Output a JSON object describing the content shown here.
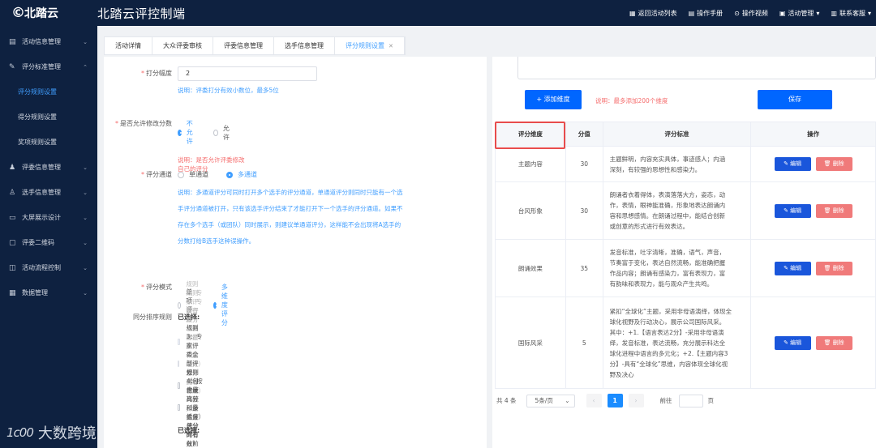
{
  "header": {
    "logo_text": "北踏云",
    "title": "北踏云评控制端",
    "actions": [
      {
        "label": "返回活动列表",
        "icon": "grid-icon"
      },
      {
        "label": "操作手册",
        "icon": "book-icon"
      },
      {
        "label": "操作视频",
        "icon": "play-icon"
      },
      {
        "label": "活动管理",
        "icon": "doc-icon",
        "dropdown": true
      },
      {
        "label": "联系客服",
        "icon": "phone-icon",
        "dropdown": true
      }
    ]
  },
  "sidebar": {
    "items": [
      {
        "label": "活动信息管理"
      },
      {
        "label": "评分标准管理",
        "expanded": true,
        "children": [
          "评分规则设置",
          "得分规则设置",
          "奖项规则设置"
        ]
      },
      {
        "label": "评委信息管理"
      },
      {
        "label": "选手信息管理"
      },
      {
        "label": "大屏展示设计"
      },
      {
        "label": "评委二维码"
      },
      {
        "label": "活动流程控制"
      },
      {
        "label": "数据管理"
      }
    ],
    "active_sub": "评分规则设置"
  },
  "watermark": {
    "logo": "1c00",
    "text": "大数跨境"
  },
  "tabs": [
    "活动详情",
    "大众评委审核",
    "评委信息管理",
    "选手信息管理",
    "评分规则设置"
  ],
  "active_tab": "评分规则设置",
  "form": {
    "step": {
      "label": "打分幅度",
      "value": "2",
      "note": "说明：评委打分有效小数位，最多5位"
    },
    "allow_modify": {
      "label": "是否允许修改分数",
      "options": [
        "不允许",
        "允许"
      ],
      "selected": "不允许",
      "note": "说明：是否允许评委修改自己的评分"
    },
    "channel": {
      "label": "评分通道",
      "options": [
        "单通道",
        "多通道"
      ],
      "selected": "多通道",
      "note_lines": [
        "说明：多通道评分可同时打开多个选手的评分通道，单通道评分则同时只能有一个选",
        "手评分通道被打开，只有该选手评分结束了才能打开下一个选手的评分通道。如果不",
        "存在多个选手（或团队）同时展示，则建议单通道评分，这样能不会出现将A选手的",
        "分数打给B选手这种误操作。"
      ]
    },
    "mode": {
      "label": "评分模式",
      "options": [
        "单项评分",
        "多维度评分"
      ],
      "selected": "多维度评分"
    },
    "tie_rule": {
      "label": "同分排序规则",
      "selected_label": "已选择:",
      "rules": [
        {
          "text": "规则1：专家评委分值高者在前（启动大众评委时有效）",
          "disabled": true
        },
        {
          "text": "规则2：专家评委有效分（去掉最高分和最低分）总分高者在前（去掉最高最低分时有效）",
          "disabled": true
        },
        {
          "text": "规则3：专家评委全部评分（包含最高分和最低分）总分高者在前",
          "disabled": false
        },
        {
          "text": "规则4：按维度比较（多维度评分时有效）",
          "disabled": false
        }
      ],
      "selected_label_2": "已选择:"
    }
  },
  "dimension": {
    "add_button": "+ 添加维度",
    "add_note": "说明：最多添加200个维度",
    "save_button": "保存",
    "columns": [
      "评分维度",
      "分值",
      "评分标准",
      "操作"
    ],
    "rows": [
      {
        "name": "主题内容",
        "score": "30",
        "standard": [
          "主题鲜明，内容充实具体，事迹感人；内涵",
          "深刻，有较强的思想性和感染力。"
        ]
      },
      {
        "name": "台风形象",
        "score": "30",
        "standard": [
          "朗诵者衣着得体，表演落落大方，姿态，动",
          "作，表情，眼神能准确，形象地表达朗诵内",
          "容和思想感情。在朗诵过程中，能结合创新",
          "或创意的形式进行有效表达。"
        ]
      },
      {
        "name": "朗诵效果",
        "score": "35",
        "standard": [
          "发音标准，吐字清晰，准确，语气，声音，",
          "节奏富于变化，表达自然流畅，能准确把握",
          "作品内容；朗诵有感染力，富有表现力，富",
          "有韵味和表现力，能与观众产生共鸣。"
        ]
      },
      {
        "name": "国际风采",
        "score": "5",
        "standard": [
          "紧扣“全球化”主题，采用非母语演绎，体现全",
          "球化视野及行动决心，展示公司国际风采。",
          "其中：+1.【语言表达2分】-采用非母语演",
          "绎，发音标准，表达流畅，充分展示科达全",
          "球化进程中语言的多元化；+2.【主题内容3",
          "分】-具有“全球化”思维，内容体现全球化视",
          "野及决心"
        ]
      }
    ],
    "edit_label": "编辑",
    "delete_label": "删除"
  },
  "pagination": {
    "total": "共 4 条",
    "page_size": "5条/页",
    "current": "1",
    "goto_label": "前往",
    "page_suffix": "页"
  },
  "colors": {
    "sidebar_bg": "#0e2140",
    "accent": "#409eff",
    "primary_button": "#0066ff",
    "danger": "#f07a7a",
    "highlight_box": "#e84c4c"
  }
}
